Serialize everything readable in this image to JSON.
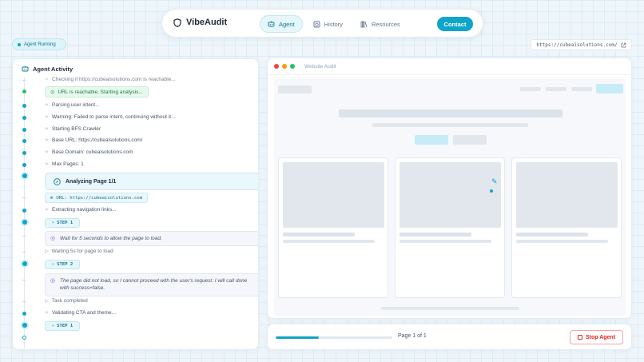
{
  "nav": {
    "brand": "VibeAudit",
    "tabs": [
      {
        "label": "Agent",
        "icon": "robot-icon"
      },
      {
        "label": "History",
        "icon": "history-icon"
      },
      {
        "label": "Resources",
        "icon": "books-icon"
      }
    ],
    "contact_label": "Contact"
  },
  "status": {
    "label": "Agent Running"
  },
  "url_bar": {
    "value": "https://cubeaisolutions.com/"
  },
  "activity": {
    "title": "Agent Activity",
    "lines": {
      "checking": "Checking if https://cubeaisolutions.com is reachable...",
      "reachable": "URL is reachable. Starting analysis...",
      "parsing": "Parsing user intent...",
      "warning": "Warning: Failed to parse intent, continuing without it...",
      "crawler": "Starting BFS Crawler",
      "base_url": "Base URL: https://cubeaisolutions.com/",
      "base_domain": "Base Domain: cubeaisolutions.com",
      "max_pages": "Max Pages: 1",
      "analyzing": "Analyzing Page 1/1",
      "url_badge": "URL: https://cubeaisolutions.com",
      "extracting": "Extracting navigation links...",
      "step1": "STEP 1",
      "thought1": "Wait for 5 seconds to allow the page to load.",
      "waiting": "Waiting 5s for page to load",
      "step2": "STEP 2",
      "thought2": "The page did not load, so I cannot proceed with the user's request. I will call done with success=false.",
      "task_completed": "Task completed",
      "validating": "Validating CTA and theme...",
      "step1b": "STEP 1"
    }
  },
  "browser": {
    "title": "Website Audit"
  },
  "footer": {
    "progress": 0.37,
    "page_label": "Page 1 of 1",
    "stop_label": "Stop Agent"
  }
}
